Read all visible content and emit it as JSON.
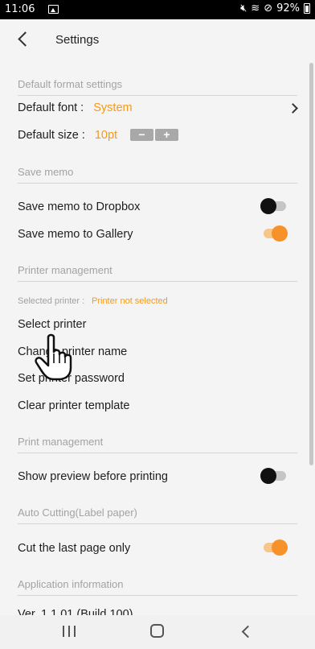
{
  "status_bar": {
    "time": "11:06",
    "battery": "92%",
    "icon_names": [
      "gallery-icon",
      "mute-icon",
      "wifi-icon",
      "do-not-disturb-icon",
      "battery-icon"
    ]
  },
  "app_bar": {
    "title": "Settings"
  },
  "format_settings": {
    "header": "Default format settings",
    "font_label": "Default font :",
    "font_value": "System",
    "size_label": "Default size :",
    "size_value": "10pt",
    "decrease": "−",
    "increase": "+"
  },
  "save_memo": {
    "header": "Save memo",
    "dropbox_label": "Save memo to Dropbox",
    "dropbox_on": false,
    "gallery_label": "Save memo to Gallery",
    "gallery_on": true
  },
  "printer_management": {
    "header": "Printer management",
    "selected_label": "Selected printer :",
    "selected_value": "Printer not selected",
    "select_printer": "Select printer",
    "change_name": "Change printer name",
    "set_password": "Set printer password",
    "clear_template": "Clear printer template"
  },
  "print_management": {
    "header": "Print management",
    "preview_label": "Show preview before printing",
    "preview_on": false
  },
  "auto_cutting": {
    "header": "Auto Cutting(Label paper)",
    "last_page_label": "Cut the last page only",
    "last_page_on": true
  },
  "app_info": {
    "header": "Application information",
    "version_text": "Ver. 1.1.01 (Build 100)"
  },
  "colors": {
    "accent": "#f29a1d",
    "section_text": "#a3a3a3",
    "toggle_on": "#f7922b"
  }
}
